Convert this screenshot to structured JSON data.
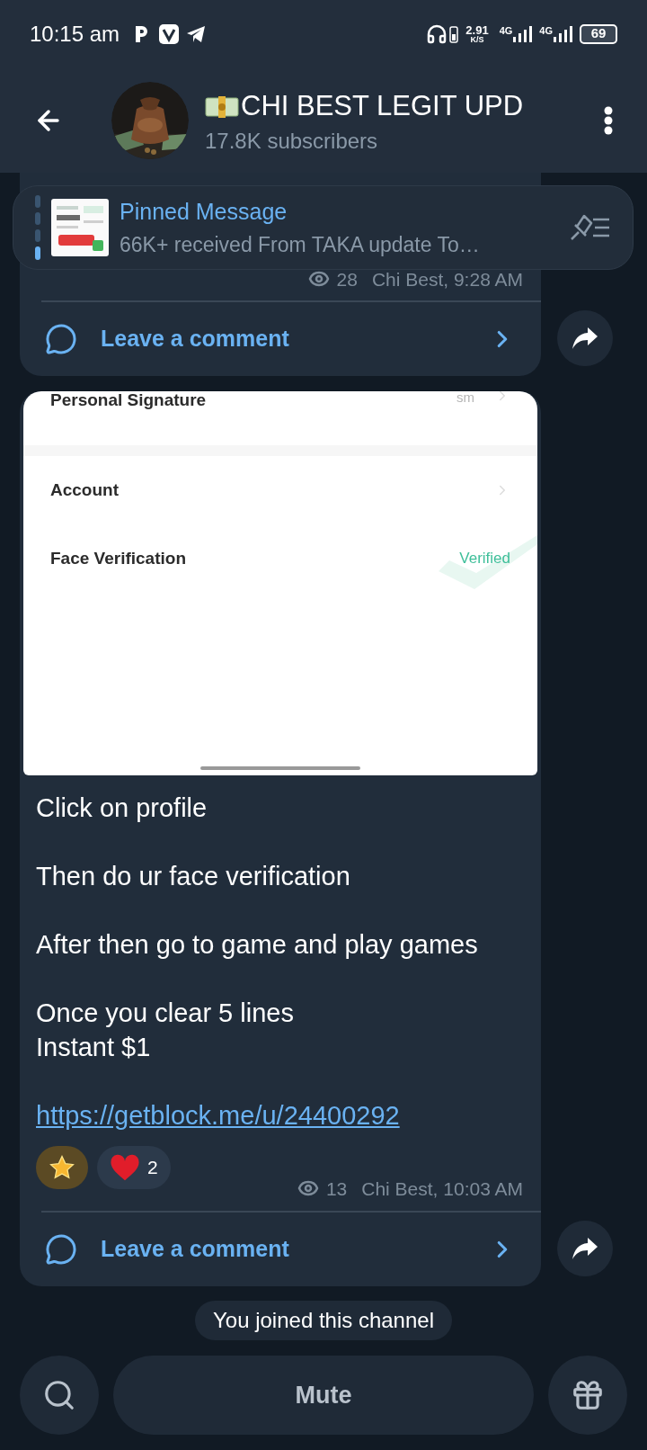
{
  "status_bar": {
    "time": "10:15 am",
    "speed": "2.91",
    "speed_unit": "K/S",
    "network_1": "4G",
    "network_2": "4G",
    "battery": "69"
  },
  "header": {
    "title": "CHI BEST LEGIT UPD",
    "subtitle": "17.8K subscribers"
  },
  "pinned": {
    "title": "Pinned Message",
    "text": "66K+ received From TAKA update To…"
  },
  "posts": [
    {
      "views": "28",
      "meta": "Chi Best, 9:28 AM",
      "comment": "Leave a comment"
    },
    {
      "screenshot": {
        "rows": [
          {
            "kind": "chevron",
            "label": "Personal Signature",
            "value": "sm"
          },
          {
            "kind": "chevron",
            "label": "Account"
          },
          {
            "kind": "status",
            "label": "Face Verification",
            "value": "Verified"
          }
        ]
      },
      "paragraphs": [
        [
          "Click on profile"
        ],
        [
          "Then do ur face verification"
        ],
        [
          "After then go to game and play games"
        ],
        [
          "Once you clear 5 lines",
          "Instant $1"
        ]
      ],
      "link": "https://getblock.me/u/24400292",
      "reactions": [
        {
          "kind": "star"
        },
        {
          "kind": "heart",
          "count": "2"
        }
      ],
      "views": "13",
      "meta": "Chi Best, 10:03 AM",
      "comment": "Leave a comment"
    }
  ],
  "service": "You joined this channel",
  "bottom": {
    "mute": "Mute"
  }
}
